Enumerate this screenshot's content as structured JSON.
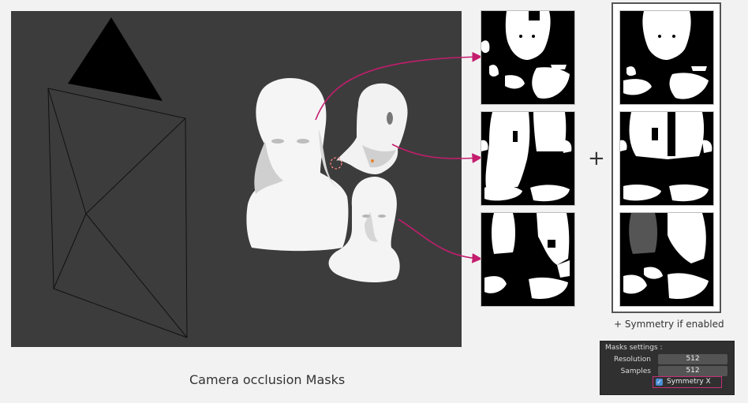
{
  "caption_main": "Camera occlusion Masks",
  "caption_symmetry": "+ Symmetry if enabled",
  "plus_sign": "+",
  "settings": {
    "title": "Masks settings :",
    "resolution_label": "Resolution",
    "resolution_value": "512",
    "samples_label": "Samples",
    "samples_value": "512",
    "symmetry_label": "Symmetry X",
    "symmetry_checked": true
  },
  "colors": {
    "viewport_bg": "#3c3c3c",
    "arrow": "#c41d6e",
    "highlight": "#c4307a"
  }
}
